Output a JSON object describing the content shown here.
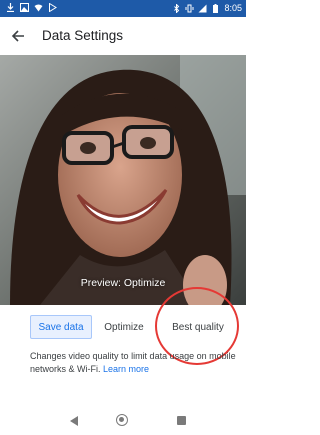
{
  "status_bar": {
    "time": "8:05",
    "battery": "▮"
  },
  "app_bar": {
    "title": "Data Settings",
    "back_icon": "arrow-left"
  },
  "preview": {
    "label": "Preview: Optimize"
  },
  "quality_tabs": {
    "save": "Save data",
    "optimize": "Optimize",
    "best": "Best quality",
    "selected": "Save data"
  },
  "description": {
    "text": "Changes video quality to limit data usage on mobile networks & Wi-Fi. ",
    "link": "Learn more"
  },
  "colors": {
    "status_bar": "#1e5aa8",
    "accent": "#1a73e8",
    "annotation": "#e53935"
  }
}
